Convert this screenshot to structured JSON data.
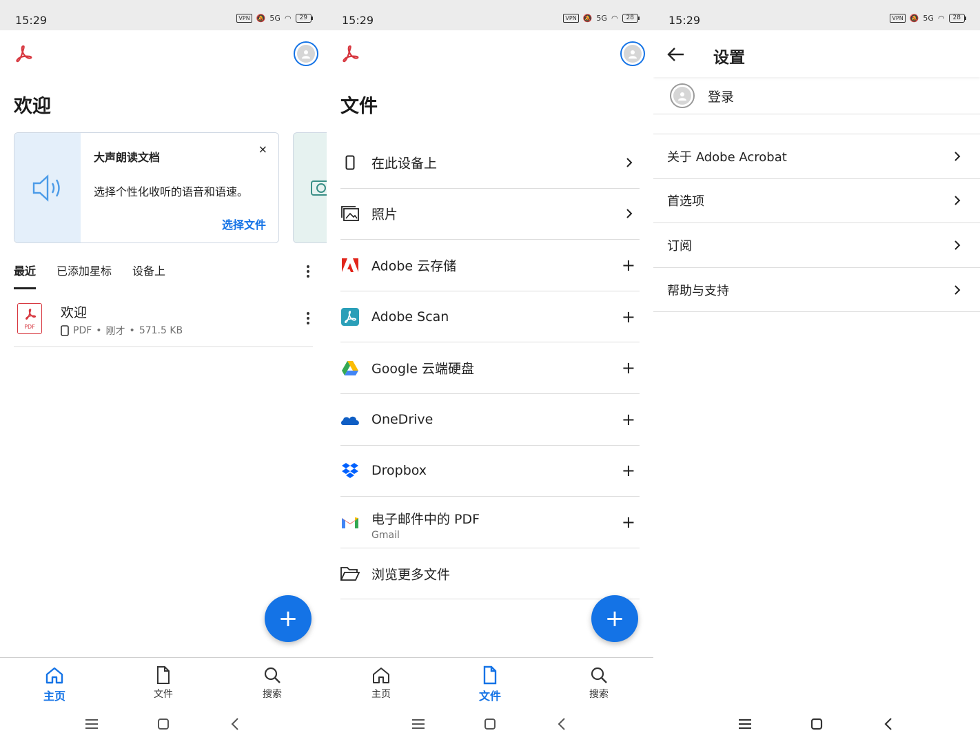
{
  "status": {
    "time": "15:29",
    "vpn": "VPN",
    "network": "5G",
    "battery_s1": "29",
    "battery_s2": "28",
    "battery_s3": "28"
  },
  "colors": {
    "accent": "#1473e6",
    "pdf_red": "#d7373f"
  },
  "home": {
    "title": "欢迎",
    "card": {
      "title": "大声朗读文档",
      "description": "选择个性化收听的语音和语速。",
      "action": "选择文件",
      "close": "×"
    },
    "tabs": [
      "最近",
      "已添加星标",
      "设备上"
    ],
    "file": {
      "name": "欢迎",
      "tag": "PDF",
      "type": "PDF",
      "time": "刚才",
      "size": "571.5 KB"
    }
  },
  "files": {
    "title": "文件",
    "items": [
      {
        "label": "在此设备上",
        "icon": "phone-icon",
        "action": "chevron"
      },
      {
        "label": "照片",
        "icon": "photos-icon",
        "action": "chevron"
      },
      {
        "label": "Adobe 云存储",
        "icon": "adobe-cloud-icon",
        "action": "+"
      },
      {
        "label": "Adobe Scan",
        "icon": "adobe-scan-icon",
        "action": "+"
      },
      {
        "label": "Google 云端硬盘",
        "icon": "google-drive-icon",
        "action": "+"
      },
      {
        "label": "OneDrive",
        "icon": "onedrive-icon",
        "action": "+"
      },
      {
        "label": "Dropbox",
        "icon": "dropbox-icon",
        "action": "+"
      },
      {
        "label": "电子邮件中的 PDF",
        "sub": "Gmail",
        "icon": "gmail-icon",
        "action": "+"
      },
      {
        "label": "浏览更多文件",
        "icon": "folder-icon",
        "action": ""
      }
    ]
  },
  "fab": {
    "label": "+"
  },
  "nav": {
    "home": "主页",
    "files": "文件",
    "search": "搜索"
  },
  "settings": {
    "title": "设置",
    "signin": "登录",
    "items": [
      "关于 Adobe Acrobat",
      "首选项",
      "订阅",
      "帮助与支持"
    ]
  }
}
